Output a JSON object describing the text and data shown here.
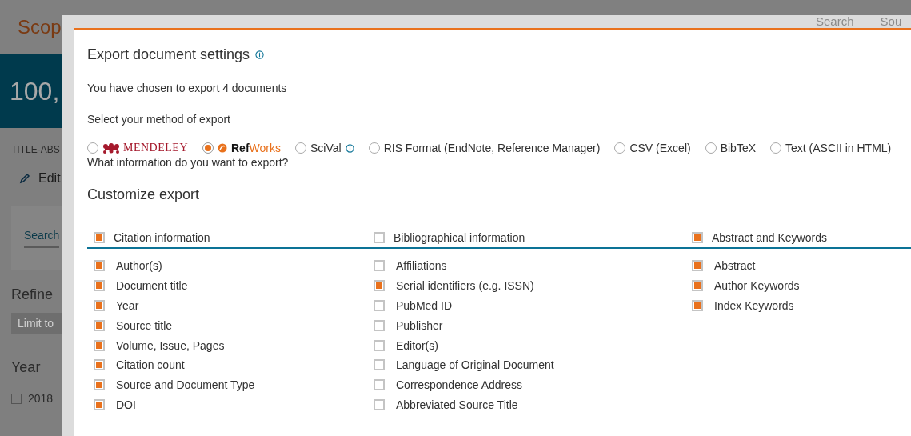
{
  "background_page": {
    "logo": "Scop",
    "header_links": [
      "Search",
      "Sou"
    ],
    "results_count": "100,",
    "query": "TITLE-ABS",
    "edit_link": "Edit",
    "search_within": "Search",
    "refine_heading": "Refine",
    "limit_button": "Limit to",
    "year_heading": "Year",
    "year_options": [
      {
        "label": "2018",
        "checked": false
      }
    ]
  },
  "dialog": {
    "title": "Export document settings",
    "summary": "You have chosen to export 4 documents",
    "method_prompt": "Select your method of export",
    "methods": [
      {
        "kind": "mendeley",
        "label": "MENDELEY",
        "selected": false,
        "info": false
      },
      {
        "kind": "refworks",
        "label": "**Ref**Works",
        "selected": true,
        "info": false
      },
      {
        "kind": "text",
        "label": "SciVal",
        "selected": false,
        "info": true
      },
      {
        "kind": "text",
        "label": "RIS Format (EndNote, Reference Manager)",
        "selected": false,
        "info": false
      },
      {
        "kind": "text",
        "label": "CSV (Excel)",
        "selected": false,
        "info": false
      },
      {
        "kind": "text",
        "label": "BibTeX",
        "selected": false,
        "info": false
      },
      {
        "kind": "text",
        "label": "Text (ASCII in HTML)",
        "selected": false,
        "info": false
      }
    ],
    "info_prompt": "What information do you want to export?",
    "customize_heading": "Customize export",
    "groups": [
      {
        "label": "Citation information",
        "checked": true,
        "items": [
          {
            "label": "Author(s)",
            "checked": true
          },
          {
            "label": "Document title",
            "checked": true
          },
          {
            "label": "Year",
            "checked": true
          },
          {
            "label": "Source title",
            "checked": true
          },
          {
            "label": "Volume, Issue, Pages",
            "checked": true
          },
          {
            "label": "Citation count",
            "checked": true
          },
          {
            "label": "Source and Document Type",
            "checked": true
          },
          {
            "label": "DOI",
            "checked": true
          }
        ]
      },
      {
        "label": "Bibliographical information",
        "checked": false,
        "items": [
          {
            "label": "Affiliations",
            "checked": false
          },
          {
            "label": "Serial identifiers (e.g. ISSN)",
            "checked": true
          },
          {
            "label": "PubMed ID",
            "checked": false
          },
          {
            "label": "Publisher",
            "checked": false
          },
          {
            "label": "Editor(s)",
            "checked": false
          },
          {
            "label": "Language of Original Document",
            "checked": false
          },
          {
            "label": "Correspondence Address",
            "checked": false
          },
          {
            "label": "Abbreviated Source Title",
            "checked": false
          }
        ]
      },
      {
        "label": "Abstract and Keywords",
        "checked": true,
        "items": [
          {
            "label": "Abstract",
            "checked": true
          },
          {
            "label": "Author Keywords",
            "checked": true
          },
          {
            "label": "Index Keywords",
            "checked": true
          }
        ]
      }
    ]
  }
}
